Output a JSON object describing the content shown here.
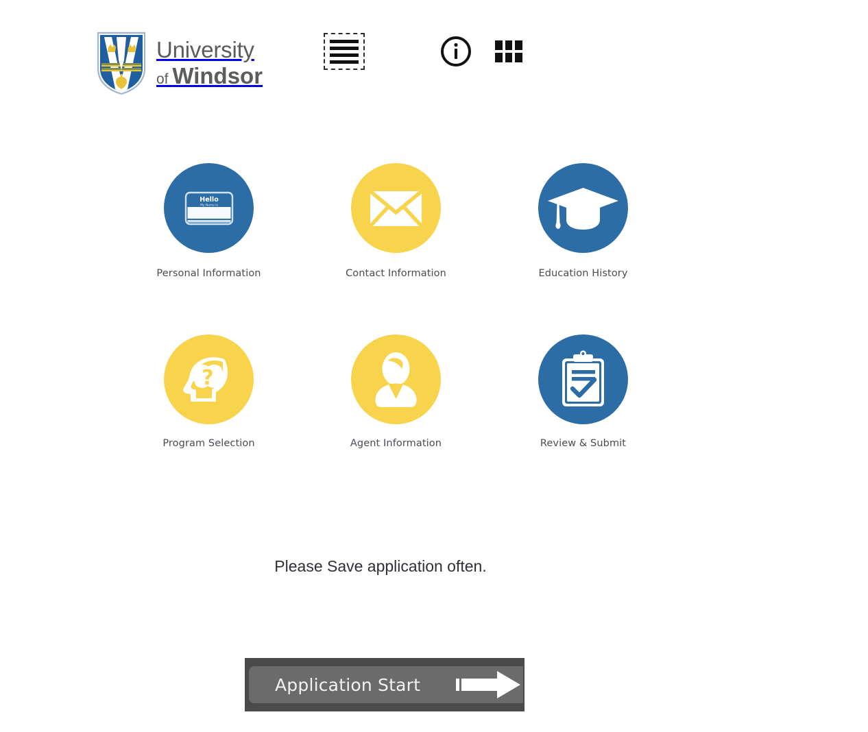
{
  "brand": {
    "logo_icon": "uwindsor-shield-icon",
    "line1": "University",
    "of": "of ",
    "name": "Windsor"
  },
  "header": {
    "menu_icon": "hamburger-menu-icon",
    "info_icon": "info-circle-icon",
    "apps_icon": "apps-grid-icon"
  },
  "tiles": [
    {
      "id": "personal-information",
      "label": "Personal Information",
      "icon": "name-tag-icon",
      "color": "#2c6da6",
      "tag_hello": "Hello",
      "tag_sub": "My Name Is"
    },
    {
      "id": "contact-information",
      "label": "Contact Information",
      "icon": "envelope-icon",
      "color": "#f7d44c"
    },
    {
      "id": "education-history",
      "label": "Education History",
      "icon": "graduation-cap-icon",
      "color": "#2c6da6"
    },
    {
      "id": "program-selection",
      "label": "Program Selection",
      "icon": "head-brain-question-icon",
      "color": "#f7d44c"
    },
    {
      "id": "agent-information",
      "label": "Agent Information",
      "icon": "person-icon",
      "color": "#f7d44c"
    },
    {
      "id": "review-submit",
      "label": "Review & Submit",
      "icon": "clipboard-check-icon",
      "color": "#2c6da6"
    }
  ],
  "notice": {
    "text": "Please Save application often."
  },
  "start_button": {
    "label": "Application Start",
    "arrow_icon": "arrow-right-icon"
  },
  "colors": {
    "blue": "#2c6da6",
    "yellow": "#f7d44c",
    "button_frame": "#4a4a4a",
    "button_face": "#6b6b6b",
    "label_text": "#4b4b52"
  }
}
